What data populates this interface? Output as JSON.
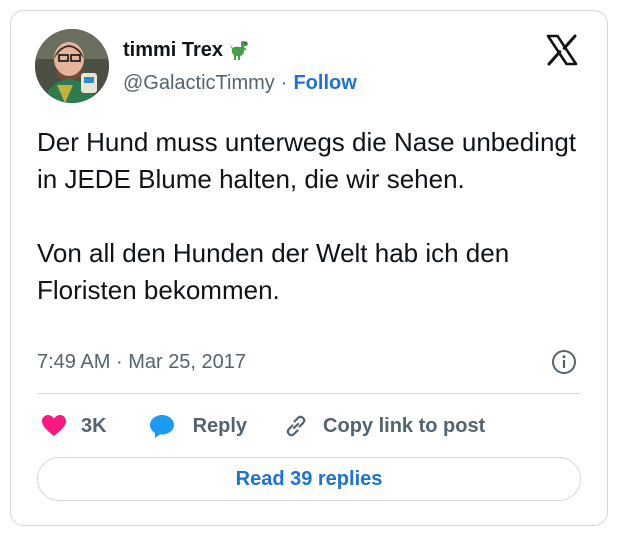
{
  "author": {
    "display_name": "timmi Trex",
    "badge_icon": "dinosaur-emoji-icon",
    "handle": "@GalacticTimmy",
    "separator": "·",
    "follow_label": "Follow",
    "avatar_icon": "profile-photo-icon"
  },
  "platform_icon": "x-logo-icon",
  "tweet": {
    "text": "Der Hund muss unterwegs die Nase unbedingt in JEDE Blume halten, die wir sehen.\n\nVon all den Hunden der Welt hab ich den Floristen bekommen."
  },
  "meta": {
    "time": "7:49 AM",
    "separator": "·",
    "date": "Mar 25, 2017",
    "info_icon": "info-icon"
  },
  "actions": {
    "like_count": "3K",
    "reply_label": "Reply",
    "copy_label": "Copy link to post"
  },
  "read_replies_label": "Read 39 replies",
  "colors": {
    "link_blue": "#1d72d2",
    "like_pink": "#f91880",
    "reply_blue": "#1d9bf0",
    "muted_gray": "#536471",
    "border": "#cfd9de"
  }
}
